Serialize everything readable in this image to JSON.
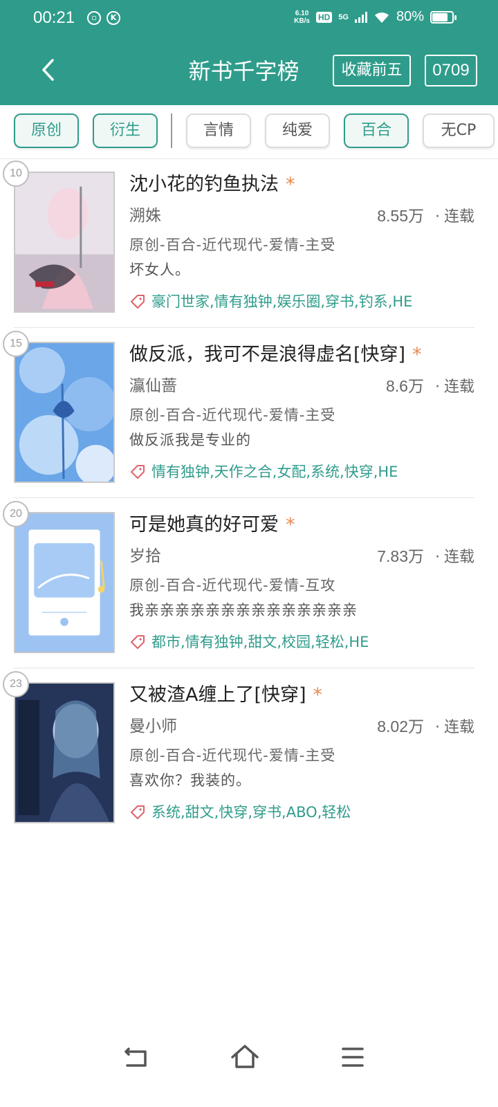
{
  "status": {
    "time": "00:21",
    "speed_top": "6.10",
    "speed_bottom": "KB/s",
    "hd": "HD",
    "net": "5G",
    "battery": "80%",
    "battery_level": 0.8
  },
  "header": {
    "title": "新书千字榜",
    "fav_btn": "收藏前五",
    "date_btn": "0709"
  },
  "filters": [
    {
      "label": "原创",
      "active": true
    },
    {
      "label": "衍生",
      "active": true
    },
    {
      "label": "言情",
      "active": false
    },
    {
      "label": "纯爱",
      "active": false
    },
    {
      "label": "百合",
      "active": true
    },
    {
      "label": "无CP",
      "active": false
    }
  ],
  "books": [
    {
      "rank": "10",
      "title": "沈小花的钓鱼执法",
      "star": "*",
      "author": "溯姝",
      "count": "8.55万",
      "dot": "·",
      "status": "连载",
      "genre": "原创-百合-近代现代-爱情-主受",
      "desc": "坏女人。",
      "tags": "豪门世家,情有独钟,娱乐圈,穿书,钓系,HE"
    },
    {
      "rank": "15",
      "title": "做反派，我可不是浪得虚名[快穿]",
      "star": "*",
      "author": "灜仙蔷",
      "count": "8.6万",
      "dot": "·",
      "status": "连载",
      "genre": "原创-百合-近代现代-爱情-主受",
      "desc": "做反派我是专业的",
      "tags": "情有独钟,天作之合,女配,系统,快穿,HE"
    },
    {
      "rank": "20",
      "title": "可是她真的好可爱",
      "star": "*",
      "author": "岁拾",
      "count": "7.83万",
      "dot": "·",
      "status": "连载",
      "genre": "原创-百合-近代现代-爱情-互攻",
      "desc": "我亲亲亲亲亲亲亲亲亲亲亲亲亲亲",
      "tags": "都市,情有独钟,甜文,校园,轻松,HE"
    },
    {
      "rank": "23",
      "title": "又被渣A缠上了[快穿]",
      "star": "*",
      "author": "曼小师",
      "count": "8.02万",
      "dot": "·",
      "status": "连载",
      "genre": "原创-百合-近代现代-爱情-主受",
      "desc": "喜欢你？我装的。",
      "tags": "系统,甜文,快穿,穿书,ABO,轻松"
    }
  ],
  "colors": {
    "brand": "#2f9c8b",
    "star": "#e8894f",
    "tag_icon": "#e0636b"
  },
  "icons": {
    "back": "chevron-left-icon",
    "tag": "tag-icon",
    "nav_back": "return-icon",
    "nav_home": "home-icon",
    "nav_menu": "menu-icon"
  }
}
